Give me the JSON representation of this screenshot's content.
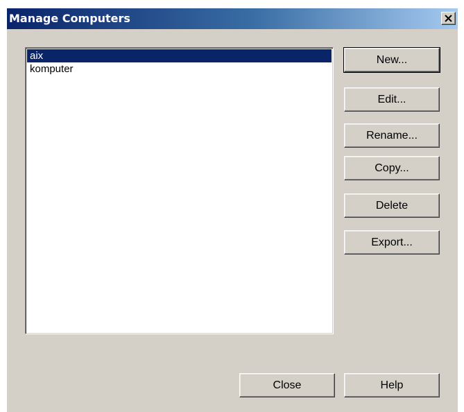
{
  "window": {
    "title": "Manage Computers",
    "close_icon": "close-icon"
  },
  "computers": {
    "items": [
      "aix",
      "komputer"
    ],
    "selected": "aix"
  },
  "buttons": {
    "new": "New...",
    "edit": "Edit...",
    "rename": "Rename...",
    "copy": "Copy...",
    "delete": "Delete",
    "export": "Export...",
    "close": "Close",
    "help": "Help"
  },
  "colors": {
    "selection_bg": "#0a246a",
    "dialog_bg": "#d4d0c8"
  }
}
